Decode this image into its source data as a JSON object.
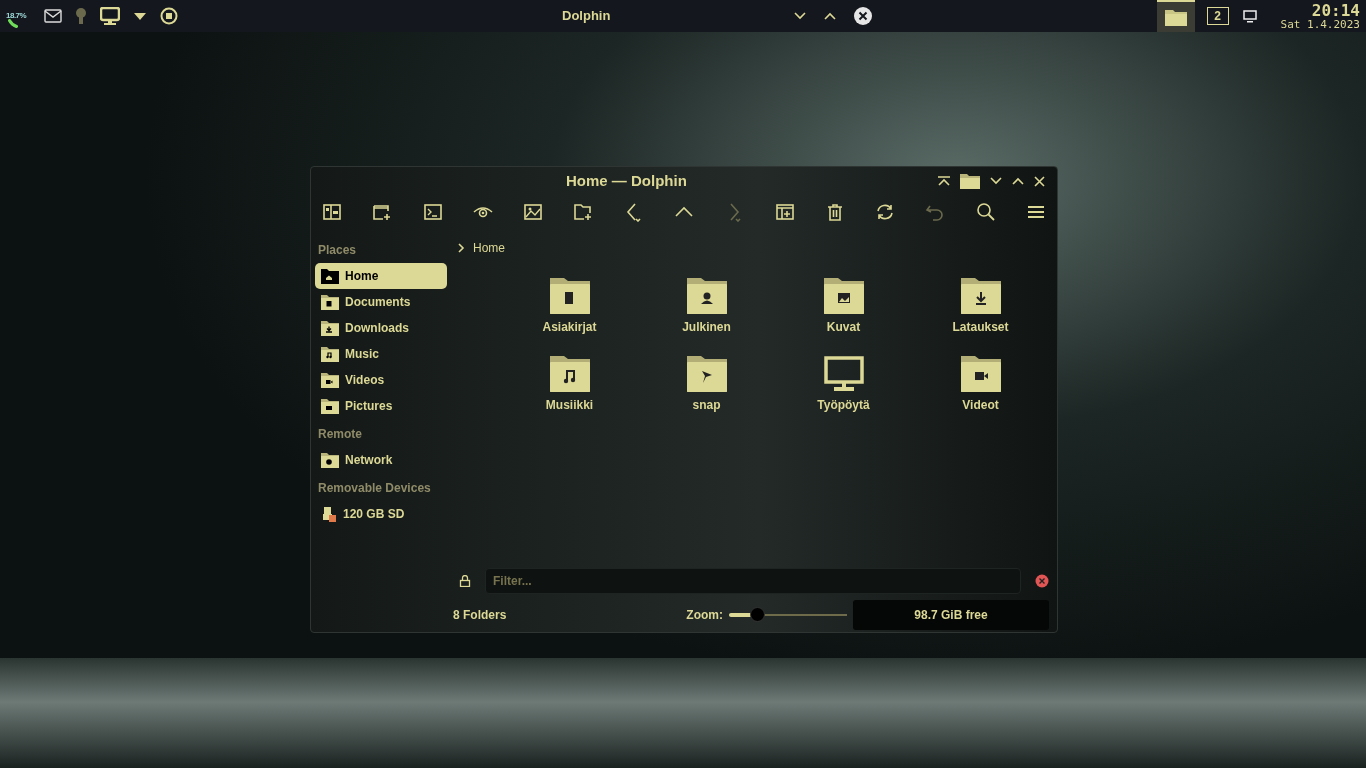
{
  "panel": {
    "cpu_reading": "18.7%",
    "window_title": "Dolphin",
    "pager_number": "2",
    "clock_time": "20:14",
    "clock_date": "Sat 1.4.2023"
  },
  "window": {
    "title": "Home — Dolphin"
  },
  "sidebar": {
    "sections": [
      {
        "heading": "Places",
        "items": [
          {
            "label": "Home",
            "selected": true
          },
          {
            "label": "Documents",
            "selected": false
          },
          {
            "label": "Downloads",
            "selected": false
          },
          {
            "label": "Music",
            "selected": false
          },
          {
            "label": "Videos",
            "selected": false
          },
          {
            "label": "Pictures",
            "selected": false
          }
        ]
      },
      {
        "heading": "Remote",
        "items": [
          {
            "label": "Network",
            "selected": false
          }
        ]
      },
      {
        "heading": "Removable Devices",
        "items": [
          {
            "label": "120 GB SD",
            "selected": false
          }
        ]
      }
    ]
  },
  "breadcrumb": {
    "items": [
      "Home"
    ]
  },
  "files": [
    {
      "name": "Asiakirjat"
    },
    {
      "name": "Julkinen"
    },
    {
      "name": "Kuvat"
    },
    {
      "name": "Lataukset"
    },
    {
      "name": "Musiikki"
    },
    {
      "name": "snap"
    },
    {
      "name": "Työpöytä"
    },
    {
      "name": "Videot"
    }
  ],
  "filter": {
    "placeholder": "Filter..."
  },
  "status_bar": {
    "summary": "8 Folders",
    "zoom_label": "Zoom:",
    "zoom": {
      "level": 0.24
    },
    "free_space": "98.7 GiB free"
  }
}
